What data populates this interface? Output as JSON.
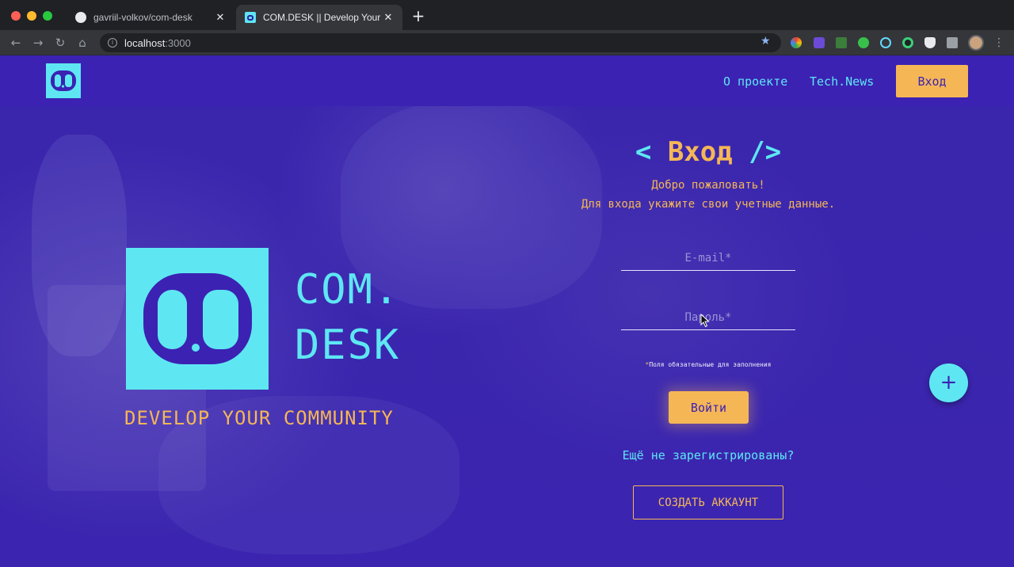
{
  "browser": {
    "tabs": [
      {
        "title": "gavriil-volkov/com-desk",
        "icon": "github-icon",
        "active": false
      },
      {
        "title": "COM.DESK || Develop Your Com",
        "icon": "comdesk-favicon",
        "active": true
      }
    ],
    "new_tab": "+",
    "close": "✕",
    "url_host": "localhost",
    "url_port": ":3000"
  },
  "navbar": {
    "about": "О проекте",
    "news": "Tech.News",
    "login": "Вход"
  },
  "hero": {
    "brand_line_1": "COM.",
    "brand_line_2": "DESK",
    "tagline": "DEVELOP YOUR COMMUNITY"
  },
  "login_form": {
    "title_open": "< ",
    "title": "Вход",
    "title_close": " />",
    "welcome": "Добро пожаловать!",
    "instruction": "Для входа укажите свои учетные данные.",
    "email_placeholder": "E-mail*",
    "password_placeholder": "Пароль*",
    "required_mark": "*",
    "required_hint": "Поля обязательные для заполнения",
    "submit": "Войти",
    "not_registered": "Ещё не зарегистрированы?",
    "create_account": "СОЗДАТЬ АККАУНТ"
  },
  "fab": {
    "label": "+"
  },
  "colors": {
    "primary": "#3b22b3",
    "accent_cyan": "#5ee7f2",
    "accent_orange": "#f5b656"
  }
}
